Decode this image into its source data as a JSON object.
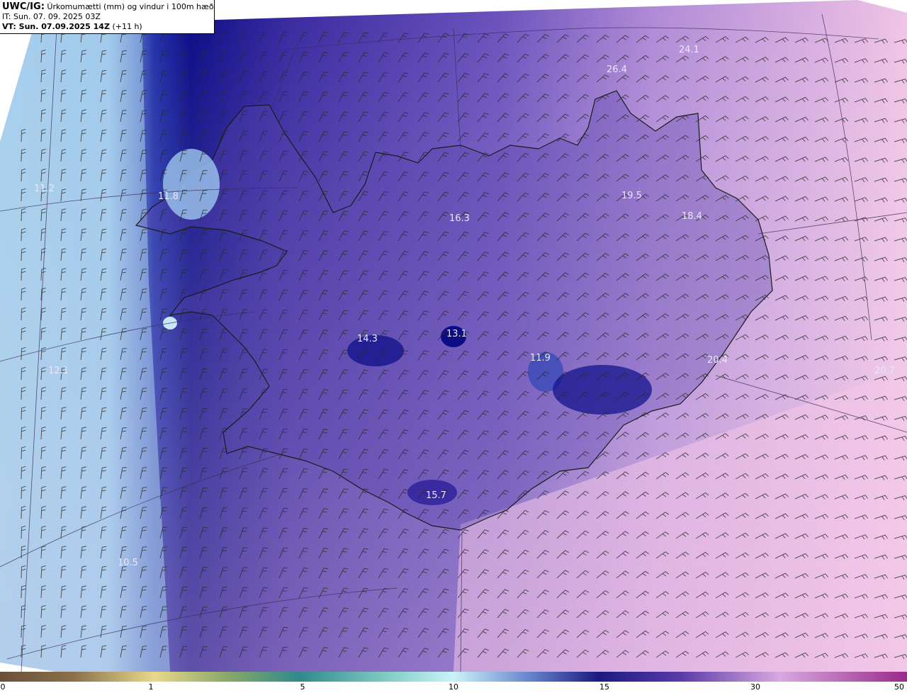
{
  "header": {
    "source": "UWC/IG:",
    "description": "Úrkomumætti (mm) og vindur i 100m hæð",
    "issue_time": "IT: Sun. 07. 09. 2025 03Z",
    "valid_prefix": "VT: Sun. 07.09.2025 14Z",
    "valid_offset": "(+11 h)"
  },
  "colorbar": {
    "ticks": [
      "0",
      "1",
      "5",
      "10",
      "15",
      "30",
      "50"
    ],
    "colors": [
      "#6b4f3a",
      "#b39a5a",
      "#e8d98a",
      "#2f8a8a",
      "#c8f4f8",
      "#1a1a80",
      "#5a3aa8",
      "#d8a8e0",
      "#9a2a8a"
    ]
  },
  "map_labels": [
    "24.1",
    "26.4",
    "19.5",
    "18.4",
    "11.8",
    "16.3",
    "14.3",
    "13.1",
    "11.9",
    "15.7",
    "20.4",
    "12.1",
    "10.5",
    "11.2",
    "20.7"
  ],
  "colors": {
    "ocean_west": "#a8d0ec",
    "low_pw": "#0a0a8a",
    "mid_pw": "#6a50b8",
    "high_pw": "#f0c0e6",
    "coast": "#1a1a1a"
  }
}
